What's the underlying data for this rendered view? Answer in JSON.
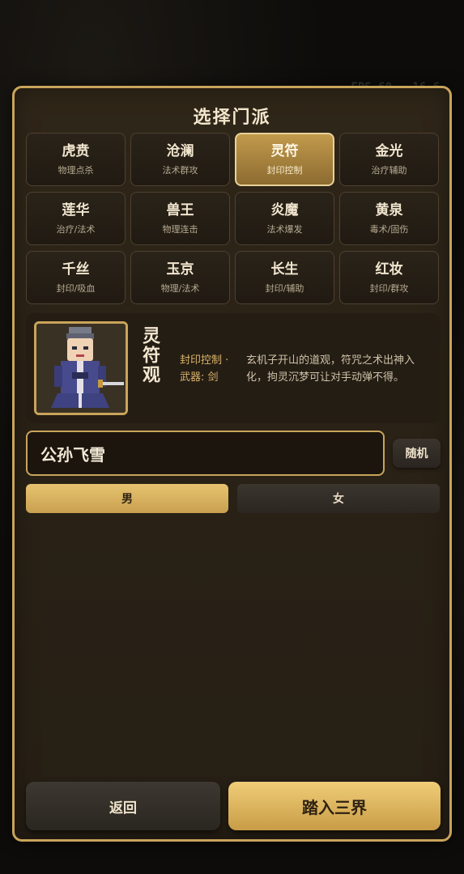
{
  "overlay": {
    "fps": "FPS 60 · 16.6"
  },
  "title": "选择门派",
  "sects": [
    {
      "name": "虎贲",
      "desc": "物理点杀",
      "selected": false
    },
    {
      "name": "沧澜",
      "desc": "法术群攻",
      "selected": false
    },
    {
      "name": "灵符",
      "desc": "封印控制",
      "selected": true
    },
    {
      "name": "金光",
      "desc": "治疗辅助",
      "selected": false
    },
    {
      "name": "莲华",
      "desc": "治疗/法术",
      "selected": false
    },
    {
      "name": "兽王",
      "desc": "物理连击",
      "selected": false
    },
    {
      "name": "炎魔",
      "desc": "法术爆发",
      "selected": false
    },
    {
      "name": "黄泉",
      "desc": "毒术/固伤",
      "selected": false
    },
    {
      "name": "千丝",
      "desc": "封印/吸血",
      "selected": false
    },
    {
      "name": "玉京",
      "desc": "物理/法术",
      "selected": false
    },
    {
      "name": "长生",
      "desc": "封印/辅助",
      "selected": false
    },
    {
      "name": "红妆",
      "desc": "封印/群攻",
      "selected": false
    }
  ],
  "detail": {
    "name": "灵符观",
    "role": "封印控制 ·",
    "weapon": "武器: 剑",
    "description": "玄机子开山的道观，符咒之术出神入化，拘灵沉梦可让对手动弹不得。"
  },
  "name_input": {
    "value": "公孙飞雪"
  },
  "random_label": "随机",
  "gender": {
    "male": "男",
    "female": "女",
    "selected": "male"
  },
  "buttons": {
    "back": "返回",
    "enter": "踏入三界"
  },
  "colors": {
    "accent_gold": "#c9a45a",
    "panel_bg": "#2a2216",
    "selected_tile": "#c29a4c"
  }
}
